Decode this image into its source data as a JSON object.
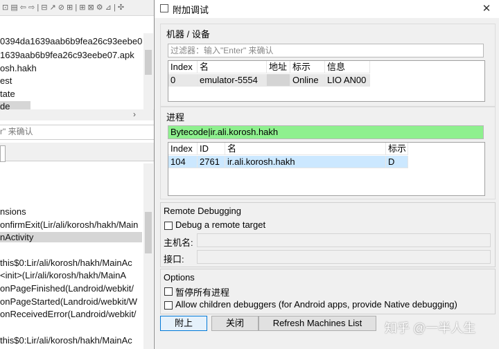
{
  "background": {
    "lines": [
      "0394da1639aab6b9fea26c93eebe0",
      "1639aab6b9fea26c93eebe07.apk",
      "osh.hakh",
      "est",
      "tate",
      "de"
    ],
    "filter_text": "r\" 来确认",
    "code_lines": [
      "nsions",
      "onfirmExit(Lir/ali/korosh/hakh/Main",
      "nActivity",
      "this$0:Lir/ali/korosh/hakh/MainAc",
      "<init>(Lir/ali/korosh/hakh/MainA",
      "onPageFinished(Landroid/webkit/",
      "onPageStarted(Landroid/webkit/W",
      "onReceivedError(Landroid/webkit/",
      "this$0:Lir/ali/korosh/hakh/MainAc"
    ]
  },
  "dialog": {
    "title": "附加调试",
    "close": "✕",
    "machines": {
      "label": "机器 / 设备",
      "filter_placeholder": "过滤器：输入\"Enter\" 来确认",
      "headers": [
        "Index",
        "名",
        "地址",
        "标示",
        "信息"
      ],
      "rows": [
        [
          "0",
          "emulator-5554",
          "",
          "Online",
          "LIO AN00"
        ]
      ]
    },
    "process": {
      "label": "进程",
      "filter_value": "Bytecode|ir.ali.korosh.hakh",
      "headers": [
        "Index",
        "ID",
        "名",
        "标示"
      ],
      "rows": [
        [
          "104",
          "2761",
          "ir.ali.korosh.hakh",
          "D"
        ]
      ]
    },
    "remote": {
      "label": "Remote Debugging",
      "checkbox": "Debug a remote target",
      "host_label": "主机名:",
      "port_label": "接口:"
    },
    "options": {
      "label": "Options",
      "pause": "暂停所有进程",
      "allow": "Allow children debuggers (for Android apps, provide Native debugging)"
    },
    "buttons": {
      "attach": "附上",
      "close": "关闭",
      "refresh": "Refresh Machines List"
    },
    "watermark": "知乎 @一半人生"
  },
  "colors": {
    "process_filter_bg": "#8ef08e",
    "selected_row": "#cce8ff"
  }
}
